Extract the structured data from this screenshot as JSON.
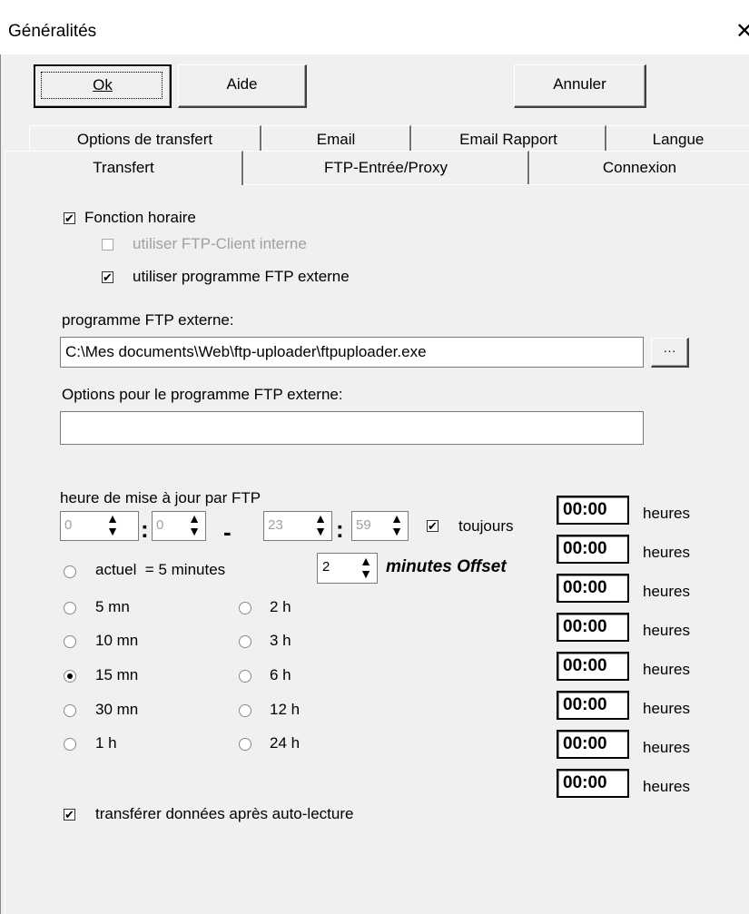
{
  "window": {
    "title": "Généralités",
    "close_glyph": "✕"
  },
  "buttons": {
    "ok": "Ok",
    "aide": "Aide",
    "annuler": "Annuler"
  },
  "tabs_row1": [
    "Options de transfert",
    "Email",
    "Email Rapport",
    "Langue"
  ],
  "tabs_row2": [
    "Transfert",
    "FTP-Entrée/Proxy",
    "Connexion"
  ],
  "active_tab": "Transfert",
  "fonction_horaire": {
    "label": "Fonction horaire",
    "checked": true
  },
  "ftp_client_interne": {
    "label": "utiliser FTP-Client interne",
    "checked": false,
    "disabled": true
  },
  "ftp_externe": {
    "label": "utiliser programme FTP externe",
    "checked": true
  },
  "programme_label": "programme FTP externe:",
  "programme_value": "C:\\Mes documents\\Web\\ftp-uploader\\ftpuploader.exe",
  "browse_label": "···",
  "options_label": "Options pour le programme FTP externe:",
  "options_value": "",
  "heure_label": "heure de mise à jour par FTP",
  "time_from": {
    "h": "0",
    "m": "0"
  },
  "time_to": {
    "h": "23",
    "m": "59"
  },
  "separator_colon": ":",
  "separator_dash": "-",
  "toujours": {
    "label": "toujours",
    "checked": true
  },
  "actuel_label": "actuel  = 5 minutes",
  "offset_value": "2",
  "offset_label": "minutes Offset",
  "intervals_left": [
    "5 mn",
    "10 mn",
    "15 mn",
    "30 mn",
    "1 h"
  ],
  "intervals_right": [
    "2 h",
    "3 h",
    "6 h",
    "12 h",
    "24 h"
  ],
  "selected_interval": "15 mn",
  "transferer": {
    "label": "transférer données après  auto-lecture",
    "checked": true
  },
  "schedule": [
    {
      "time": "00:00",
      "unit": "heures"
    },
    {
      "time": "00:00",
      "unit": "heures"
    },
    {
      "time": "00:00",
      "unit": "heures"
    },
    {
      "time": "00:00",
      "unit": "heures"
    },
    {
      "time": "00:00",
      "unit": "heures"
    },
    {
      "time": "00:00",
      "unit": "heures"
    },
    {
      "time": "00:00",
      "unit": "heures"
    },
    {
      "time": "00:00",
      "unit": "heures"
    }
  ]
}
